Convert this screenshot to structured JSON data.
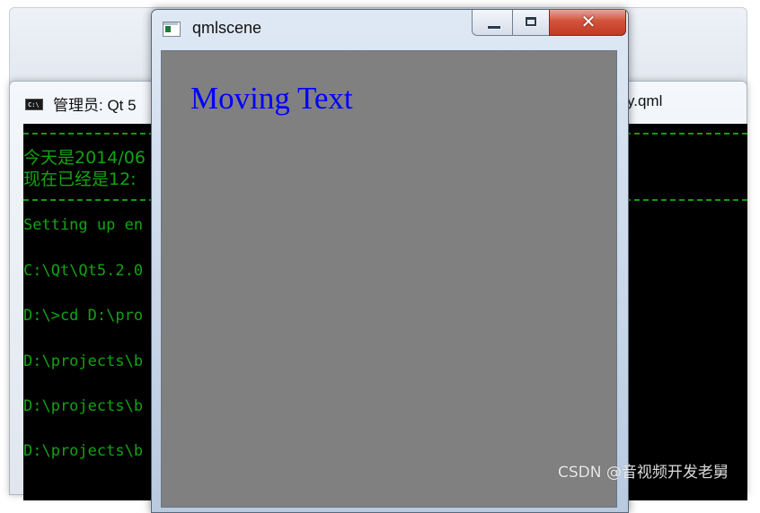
{
  "console_window": {
    "title": "管理员: Qt 5",
    "title_right": "y.qml",
    "icon": "cmd-icon",
    "lines": [
      "今天是2014/06",
      "现在已经是12:",
      "Setting up en",
      "C:\\Qt\\Qt5.2.0",
      "D:\\>cd D:\\pro",
      "D:\\projects\\b",
      "D:\\projects\\b",
      "D:\\projects\\b"
    ],
    "text_color": "#13a313",
    "background": "#000000"
  },
  "qml_window": {
    "title": "qmlscene",
    "icon": "qml-app-icon",
    "minimize_glyph": "—",
    "maximize_glyph": "□",
    "close_glyph": "✕",
    "content": {
      "text": "Moving Text",
      "text_color": "#0000ff",
      "background": "#808080"
    }
  },
  "watermark": "CSDN @音视频开发老舅"
}
